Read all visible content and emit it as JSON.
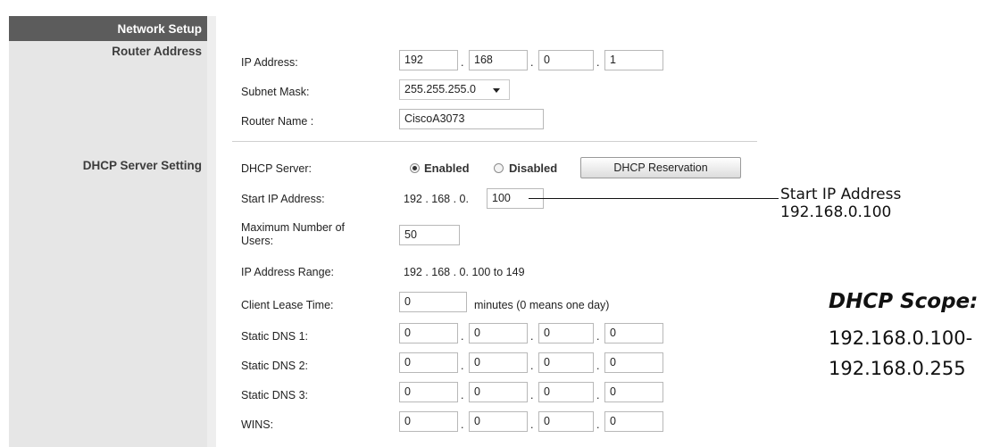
{
  "sidebar": {
    "title": "Network Setup",
    "router_address_label": "Router Address",
    "dhcp_label": "DHCP Server Setting"
  },
  "router": {
    "ip_label": "IP Address:",
    "ip": [
      "192",
      "168",
      "0",
      "1"
    ],
    "subnet_label": "Subnet Mask:",
    "subnet_value": "255.255.255.0",
    "name_label": "Router Name :",
    "name_value": "CiscoA3073"
  },
  "dhcp": {
    "server_label": "DHCP Server:",
    "enabled_label": "Enabled",
    "disabled_label": "Disabled",
    "server_state": "Enabled",
    "reservation_button": "DHCP Reservation",
    "start_ip_label": "Start IP Address:",
    "start_ip_prefix": "192 . 168 . 0.",
    "start_ip_last": "100",
    "max_users_label": "Maximum Number of Users:",
    "max_users_value": "50",
    "range_label": "IP Address Range:",
    "range_value": "192 . 168 . 0. 100 to 149",
    "lease_label": "Client Lease Time:",
    "lease_value": "0",
    "lease_note": "minutes (0 means one day)",
    "dns1_label": "Static DNS 1:",
    "dns1": [
      "0",
      "0",
      "0",
      "0"
    ],
    "dns2_label": "Static DNS 2:",
    "dns2": [
      "0",
      "0",
      "0",
      "0"
    ],
    "dns3_label": "Static DNS 3:",
    "dns3": [
      "0",
      "0",
      "0",
      "0"
    ],
    "wins_label": "WINS:",
    "wins": [
      "0",
      "0",
      "0",
      "0"
    ]
  },
  "annotations": {
    "callout_line1": "Start IP Address",
    "callout_line2": "192.168.0.100",
    "scope_title": "DHCP Scope:",
    "scope_line1": "192.168.0.100-",
    "scope_line2": "192.168.0.255"
  }
}
